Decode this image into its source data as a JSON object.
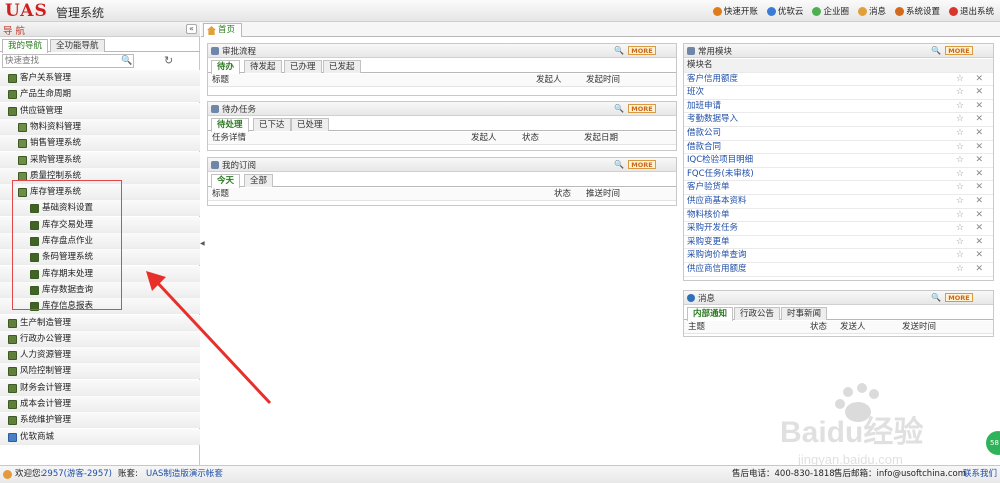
{
  "header": {
    "logo": "UAS",
    "title": "管理系统",
    "links": [
      {
        "label": "快速开账",
        "color": "#e07b1a",
        "icon": "quick-start-icon"
      },
      {
        "label": "优软云",
        "color": "#3a7bd5",
        "icon": "cloud-icon"
      },
      {
        "label": "企业圈",
        "color": "#4caf50",
        "icon": "circle-icon"
      },
      {
        "label": "消息",
        "color": "#e0a13a",
        "icon": "message-icon"
      },
      {
        "label": "系统设置",
        "color": "#d2691e",
        "icon": "settings-icon"
      },
      {
        "label": "退出系统",
        "color": "#d9362b",
        "icon": "power-icon"
      }
    ]
  },
  "sidebar": {
    "title": "导 航",
    "collapse": "«",
    "tabs": [
      "我的导航",
      "全功能导航"
    ],
    "search_placeholder": "快速查找",
    "items": [
      {
        "label": "客户关系管理"
      },
      {
        "label": "产品生命周期"
      },
      {
        "label": "供应链管理"
      },
      {
        "label": "物料资料管理"
      },
      {
        "label": "销售管理系统"
      },
      {
        "label": "采购管理系统"
      },
      {
        "label": "质量控制系统"
      },
      {
        "label": "库存管理系统"
      },
      {
        "label": "基础资料设置"
      },
      {
        "label": "库存交易处理"
      },
      {
        "label": "库存盘点作业"
      },
      {
        "label": "条码管理系统"
      },
      {
        "label": "库存期末处理"
      },
      {
        "label": "库存数据查询"
      },
      {
        "label": "库存信息报表"
      },
      {
        "label": "生产制造管理"
      },
      {
        "label": "行政办公管理"
      },
      {
        "label": "人力资源管理"
      },
      {
        "label": "风险控制管理"
      },
      {
        "label": "财务会计管理"
      },
      {
        "label": "成本会计管理"
      },
      {
        "label": "系统维护管理"
      },
      {
        "label": "优软商城"
      }
    ]
  },
  "main": {
    "home_tab": "首页",
    "more_label": "MORE",
    "approval": {
      "title": "审批流程",
      "tabs": [
        "待办",
        "待发起",
        "已办理",
        "已发起"
      ],
      "cols": [
        "标题",
        "发起人",
        "发起时间"
      ]
    },
    "tasks": {
      "title": "待办任务",
      "tabs": [
        "待处理",
        "已下达",
        "已处理"
      ],
      "cols": [
        "任务详情",
        "发起人",
        "状态",
        "发起日期"
      ]
    },
    "subs": {
      "title": "我的订阅",
      "tabs": [
        "今天",
        "全部"
      ],
      "cols": [
        "标题",
        "状态",
        "推送时间"
      ]
    },
    "modules": {
      "title": "常用模块",
      "header": "模块名",
      "items": [
        "客户信用额度",
        "班次",
        "加班申请",
        "考勤数据导入",
        "借款公司",
        "借款合同",
        "IQC检验项目明细",
        "FQC任务(未审核)",
        "客户验货单",
        "供应商基本资料",
        "物料核价单",
        "采购开发任务",
        "采购变更单",
        "采购询价单查询",
        "供应商信用额度"
      ]
    },
    "messages": {
      "title": "消息",
      "tabs": [
        "内部通知",
        "行政公告",
        "时事新闻"
      ],
      "cols": [
        "主题",
        "状态",
        "发送人",
        "发送时间"
      ]
    }
  },
  "footer": {
    "welcome": "欢迎您:",
    "user": "2957(游客-2957)",
    "account_label": "账套:",
    "account": "UAS制造版演示帐套",
    "support": "售后电话：400-830-1818",
    "mail": "售后邮箱：info@usoftchina.com",
    "contact": "联系我们"
  },
  "watermark": {
    "brand": "Baidu经验",
    "url": "jingyan.baidu.com"
  }
}
